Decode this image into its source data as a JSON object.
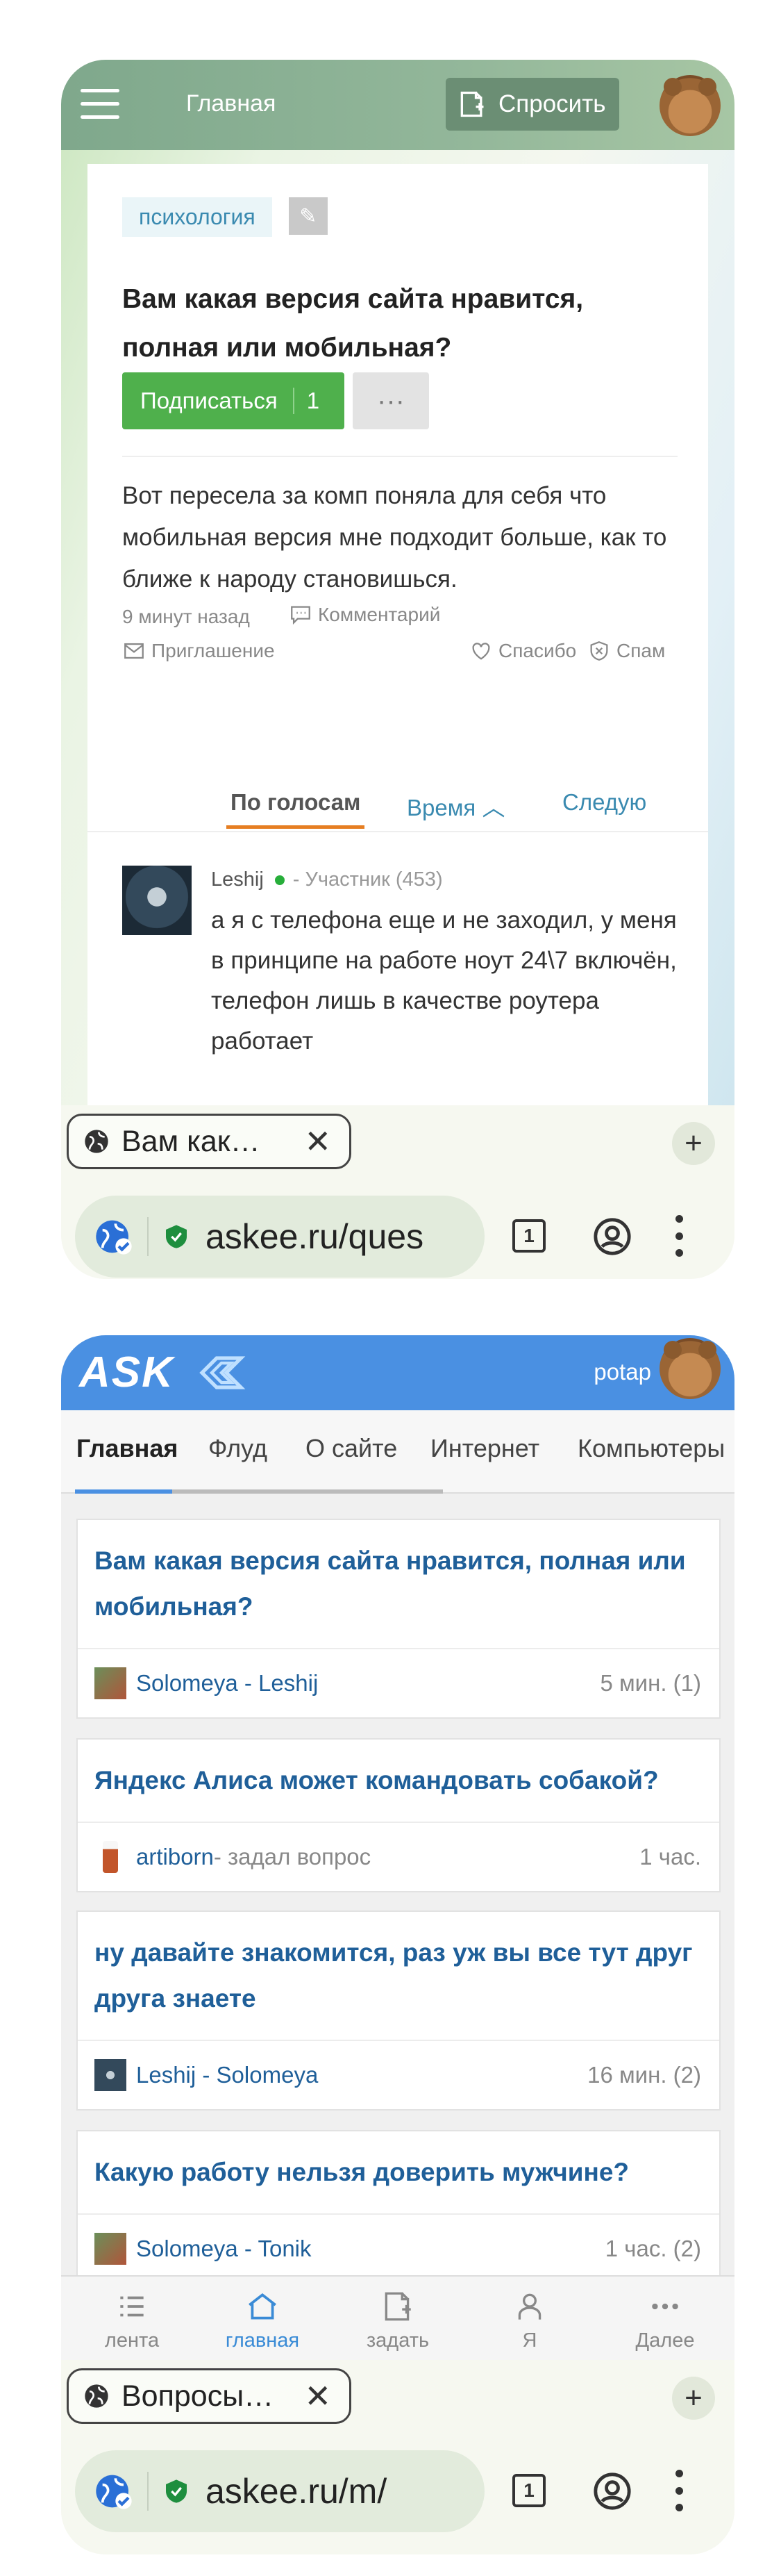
{
  "phone1": {
    "header": {
      "title": "Главная",
      "ask_label": "Спросить"
    },
    "question": {
      "tag": "психология",
      "title": "Вам какая версия сайта нравится, полная или мобильная?",
      "subscribe_label": "Подписаться",
      "subscribe_count": "1",
      "more_label": "···",
      "body": "Вот пересела за комп поняла для себя что мобильная версия мне подходит больше, как то ближе к народу становишься.",
      "time_ago": "9 минут назад",
      "comment_label": "Комментарий",
      "invite_label": "Приглашение",
      "thanks_label": "Спасибо",
      "spam_label": "Спам"
    },
    "sort_tabs": {
      "votes": "По голосам",
      "time": "Время",
      "follow": "Следую"
    },
    "answer": {
      "author": "Leshij",
      "role": "- Участник (453)",
      "text": "а я с телефона еще и не заходил, у меня в принципе на работе ноут 24\\7 включён, телефон лишь в качестве роутера работает"
    },
    "browser": {
      "tab_title": "Вам как…",
      "url": "askee.ru/ques",
      "tab_count": "1"
    }
  },
  "phone2": {
    "header": {
      "logo": "ASK",
      "username": "potap"
    },
    "nav": [
      "Главная",
      "Флуд",
      "О сайте",
      "Интернет",
      "Компьютеры"
    ],
    "feed": [
      {
        "question": "Вам какая версия сайта нравится, полная или мобильная?",
        "users": "Solomeya - Leshij",
        "action": "",
        "time": "5 мин. (1)"
      },
      {
        "question": "Яндекс Алиса может командовать собакой?",
        "users": "artiborn",
        "action": " - задал вопрос",
        "time": "1 час."
      },
      {
        "question": "ну давайте знакомится, раз уж вы все тут друг друга знаете",
        "users": "Leshij - Solomeya",
        "action": "",
        "time": "16 мин. (2)"
      },
      {
        "question": "Какую работу нельзя доверить мужчине?",
        "users": "Solomeya - Tonik",
        "action": "",
        "time": "1 час. (2)"
      }
    ],
    "bottom_nav": [
      "лента",
      "главная",
      "задать",
      "Я",
      "Далее"
    ],
    "browser": {
      "tab_title": "Вопросы…",
      "url": "askee.ru/m/",
      "tab_count": "1"
    }
  },
  "colors": {
    "accent_green": "#4fb04c",
    "link_blue": "#1f5f99",
    "header_blue": "#4a90e2",
    "header_green": "#7fa88c"
  }
}
